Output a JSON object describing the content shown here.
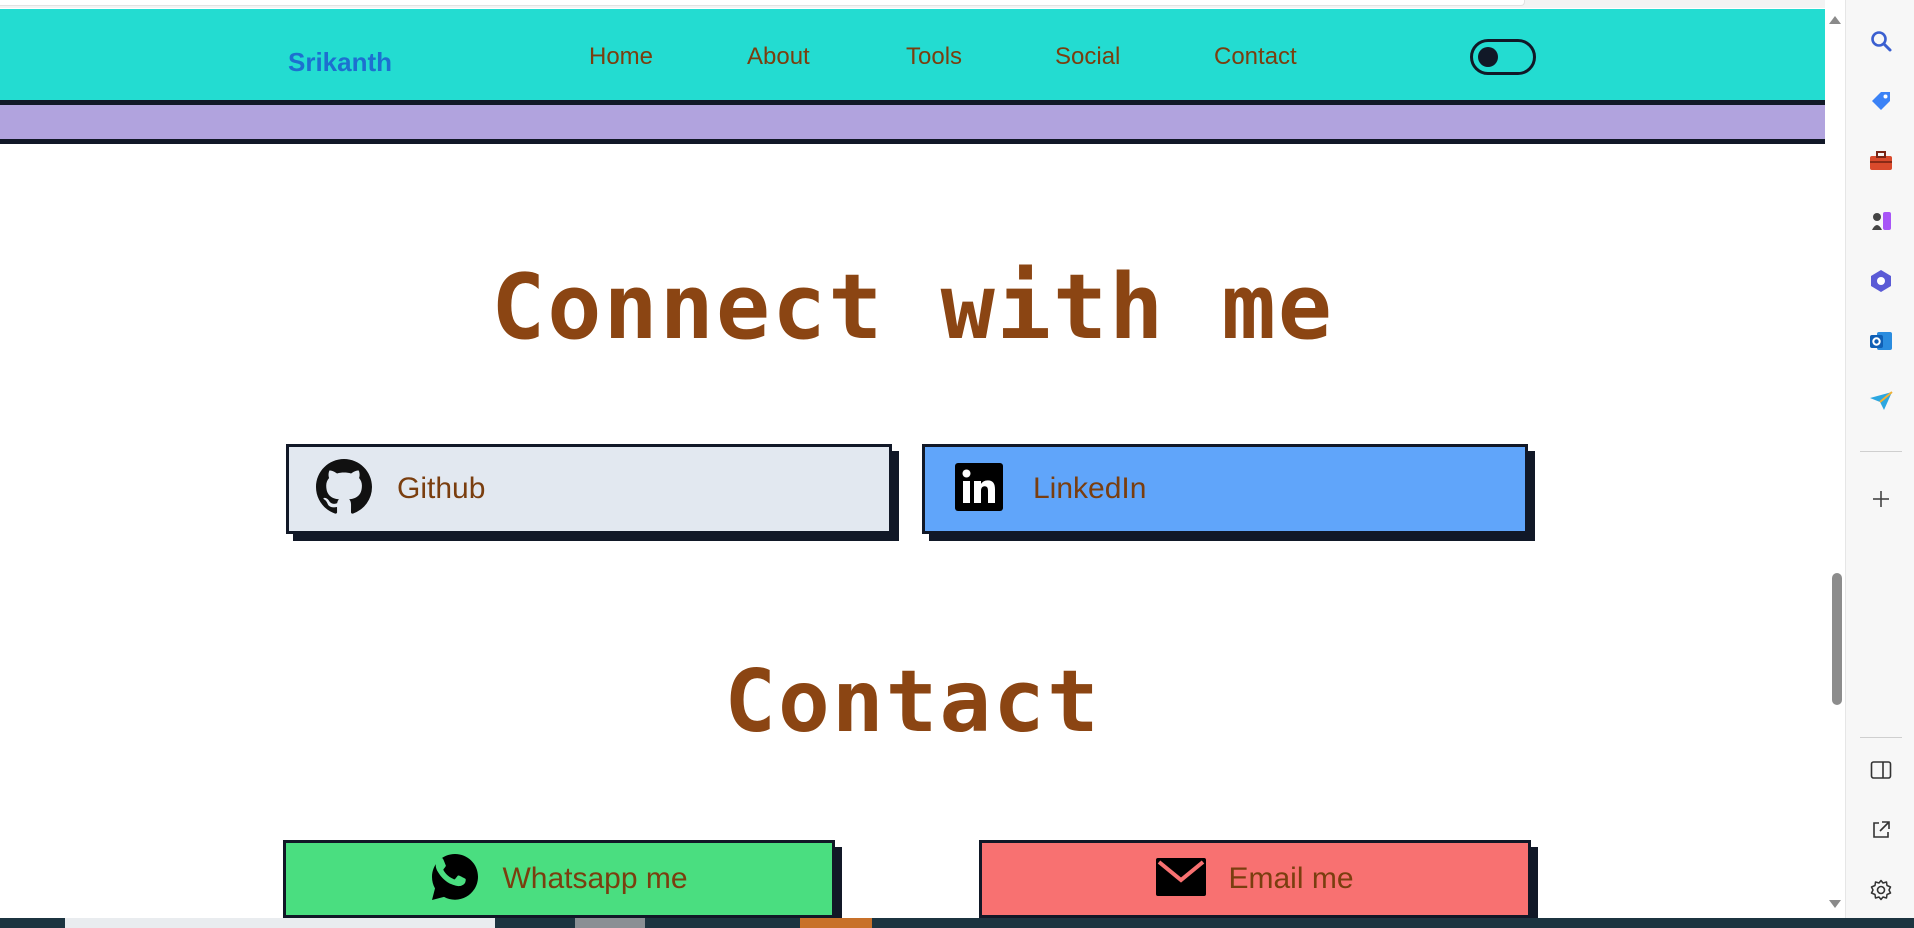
{
  "site": {
    "brand": "Srikanth",
    "nav": [
      {
        "label": "Home"
      },
      {
        "label": "About"
      },
      {
        "label": "Tools"
      },
      {
        "label": "Social"
      },
      {
        "label": "Contact"
      }
    ],
    "theme_toggle": {
      "state": "off"
    }
  },
  "connect": {
    "heading": "Connect with me",
    "links": [
      {
        "label": "Github",
        "icon": "github-icon",
        "color": "#e2e8f0"
      },
      {
        "label": "LinkedIn",
        "icon": "linkedin-icon",
        "color": "#60a5fa"
      }
    ]
  },
  "contact": {
    "heading": "Contact",
    "buttons": [
      {
        "label": "Whatsapp me",
        "icon": "whatsapp-icon",
        "color": "#4ade80"
      },
      {
        "label": "Email me",
        "icon": "mail-icon",
        "color": "#f87171"
      }
    ]
  },
  "colors": {
    "navbar": "#23dcd1",
    "accent_bar": "#b1a3de",
    "heading_text": "#8b4513",
    "brand_text": "#1d6fd0",
    "border": "#111827"
  },
  "browser_sidebar": {
    "icons": [
      "search-icon",
      "tag-icon",
      "toolbox-icon",
      "chess-icon",
      "copilot-icon",
      "outlook-icon",
      "send-icon",
      "add-icon",
      "split-screen-icon",
      "open-external-icon",
      "settings-icon"
    ]
  }
}
